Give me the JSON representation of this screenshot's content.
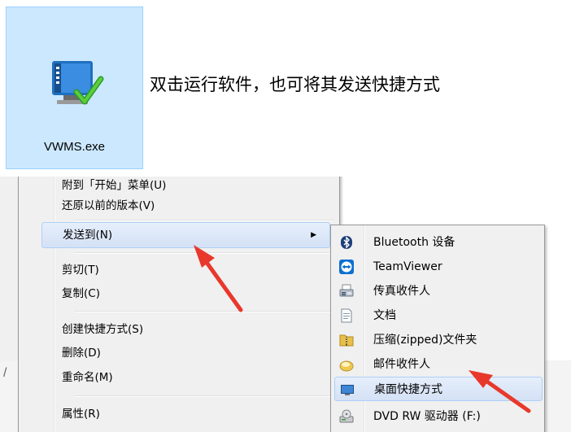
{
  "file": {
    "name": "VWMS.exe"
  },
  "instruction": "双击运行软件，也可将其发送快捷方式",
  "context_menu": {
    "items": [
      {
        "label": "附到「开始」菜单(U)"
      },
      {
        "label": "还原以前的版本(V)"
      },
      {
        "label": "发送到(N)",
        "has_submenu": true,
        "highlighted": true
      },
      {
        "label": "剪切(T)"
      },
      {
        "label": "复制(C)"
      },
      {
        "label": "创建快捷方式(S)"
      },
      {
        "label": "删除(D)"
      },
      {
        "label": "重命名(M)"
      },
      {
        "label": "属性(R)"
      }
    ]
  },
  "send_to_menu": {
    "items": [
      {
        "label": "Bluetooth 设备",
        "icon": "bluetooth-icon"
      },
      {
        "label": "TeamViewer",
        "icon": "teamviewer-icon"
      },
      {
        "label": "传真收件人",
        "icon": "fax-icon"
      },
      {
        "label": "文档",
        "icon": "document-icon"
      },
      {
        "label": "压缩(zipped)文件夹",
        "icon": "zip-folder-icon"
      },
      {
        "label": "邮件收件人",
        "icon": "mail-icon"
      },
      {
        "label": "桌面快捷方式",
        "icon": "desktop-icon",
        "highlighted": true
      },
      {
        "label": "DVD RW 驱动器 (F:)",
        "icon": "dvd-drive-icon"
      }
    ]
  },
  "background_text": "/",
  "colors": {
    "highlight": "#d4e1f5",
    "accent_arrow": "#e8382c",
    "selection_tile": "#cce8ff"
  }
}
